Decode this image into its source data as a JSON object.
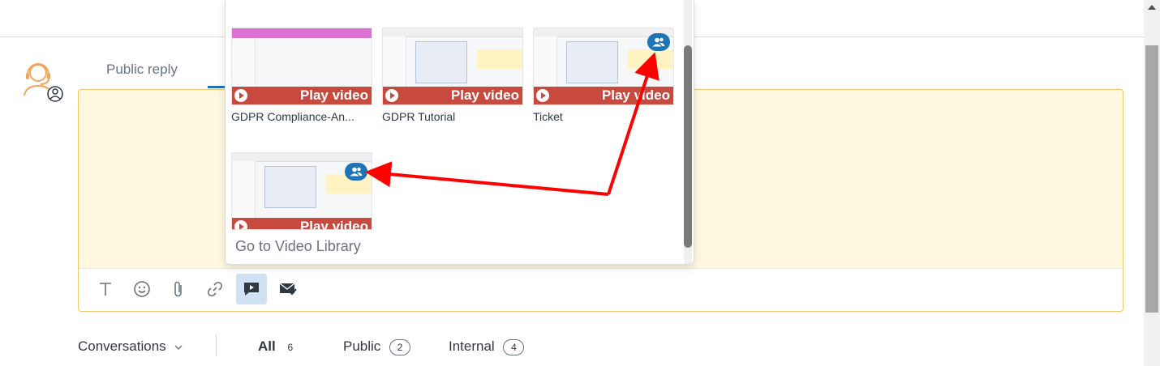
{
  "reply_tabs": {
    "public_reply": "Public reply"
  },
  "video_popup": {
    "videos": [
      {
        "title": "GDPR Compliance-An...",
        "play_label": "Play video",
        "shared": false
      },
      {
        "title": "GDPR Tutorial",
        "play_label": "Play video",
        "shared": false
      },
      {
        "title": "Ticket",
        "play_label": "Play video",
        "shared": true
      },
      {
        "title": "",
        "play_label": "Play video",
        "shared": true
      }
    ],
    "go_to_library": "Go to Video Library"
  },
  "toolbar": {
    "items": [
      {
        "icon": "text-format-icon"
      },
      {
        "icon": "emoji-icon"
      },
      {
        "icon": "attachment-icon"
      },
      {
        "icon": "link-icon"
      },
      {
        "icon": "video-message-icon",
        "active": true
      },
      {
        "icon": "mail-check-icon"
      }
    ]
  },
  "conversations": {
    "dropdown_label": "Conversations",
    "filters": [
      {
        "label": "All",
        "count": "6",
        "active": true
      },
      {
        "label": "Public",
        "count": "2"
      },
      {
        "label": "Internal",
        "count": "4"
      }
    ]
  },
  "colors": {
    "accent": "#1f73b7",
    "editor_bg": "#fff8e1",
    "play_bar": "#c84a3f",
    "annotation_arrow": "#ff0000"
  }
}
